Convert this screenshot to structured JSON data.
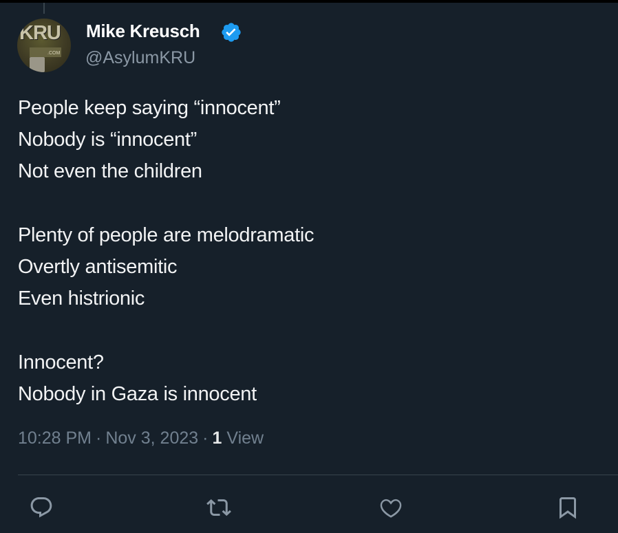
{
  "author": {
    "display_name": "Mike Kreusch",
    "handle": "@AsylumKRU",
    "verified_badge_color": "#1d9bf0",
    "avatar": {
      "logo_text": "KRU",
      "logo_suffix": ".COM"
    }
  },
  "tweet": {
    "lines": [
      "People keep saying “innocent”",
      "Nobody is “innocent”",
      "Not even the children",
      "",
      "Plenty of people are melodramatic",
      "Overtly antisemitic",
      "Even histrionic",
      "",
      "Innocent?",
      "Nobody in Gaza is innocent"
    ]
  },
  "meta": {
    "time": "10:28 PM",
    "separator": "·",
    "date": "Nov 3, 2023",
    "views_count": "1",
    "views_label": "View"
  },
  "actions": [
    {
      "name": "reply",
      "icon": "reply-icon"
    },
    {
      "name": "retweet",
      "icon": "retweet-icon"
    },
    {
      "name": "like",
      "icon": "heart-icon"
    },
    {
      "name": "bookmark",
      "icon": "bookmark-icon"
    }
  ],
  "colors": {
    "background": "#16202a",
    "text": "#e7e9ea",
    "secondary_text": "#8b98a5",
    "divider": "#38444d",
    "icon": "#8b98a5"
  }
}
